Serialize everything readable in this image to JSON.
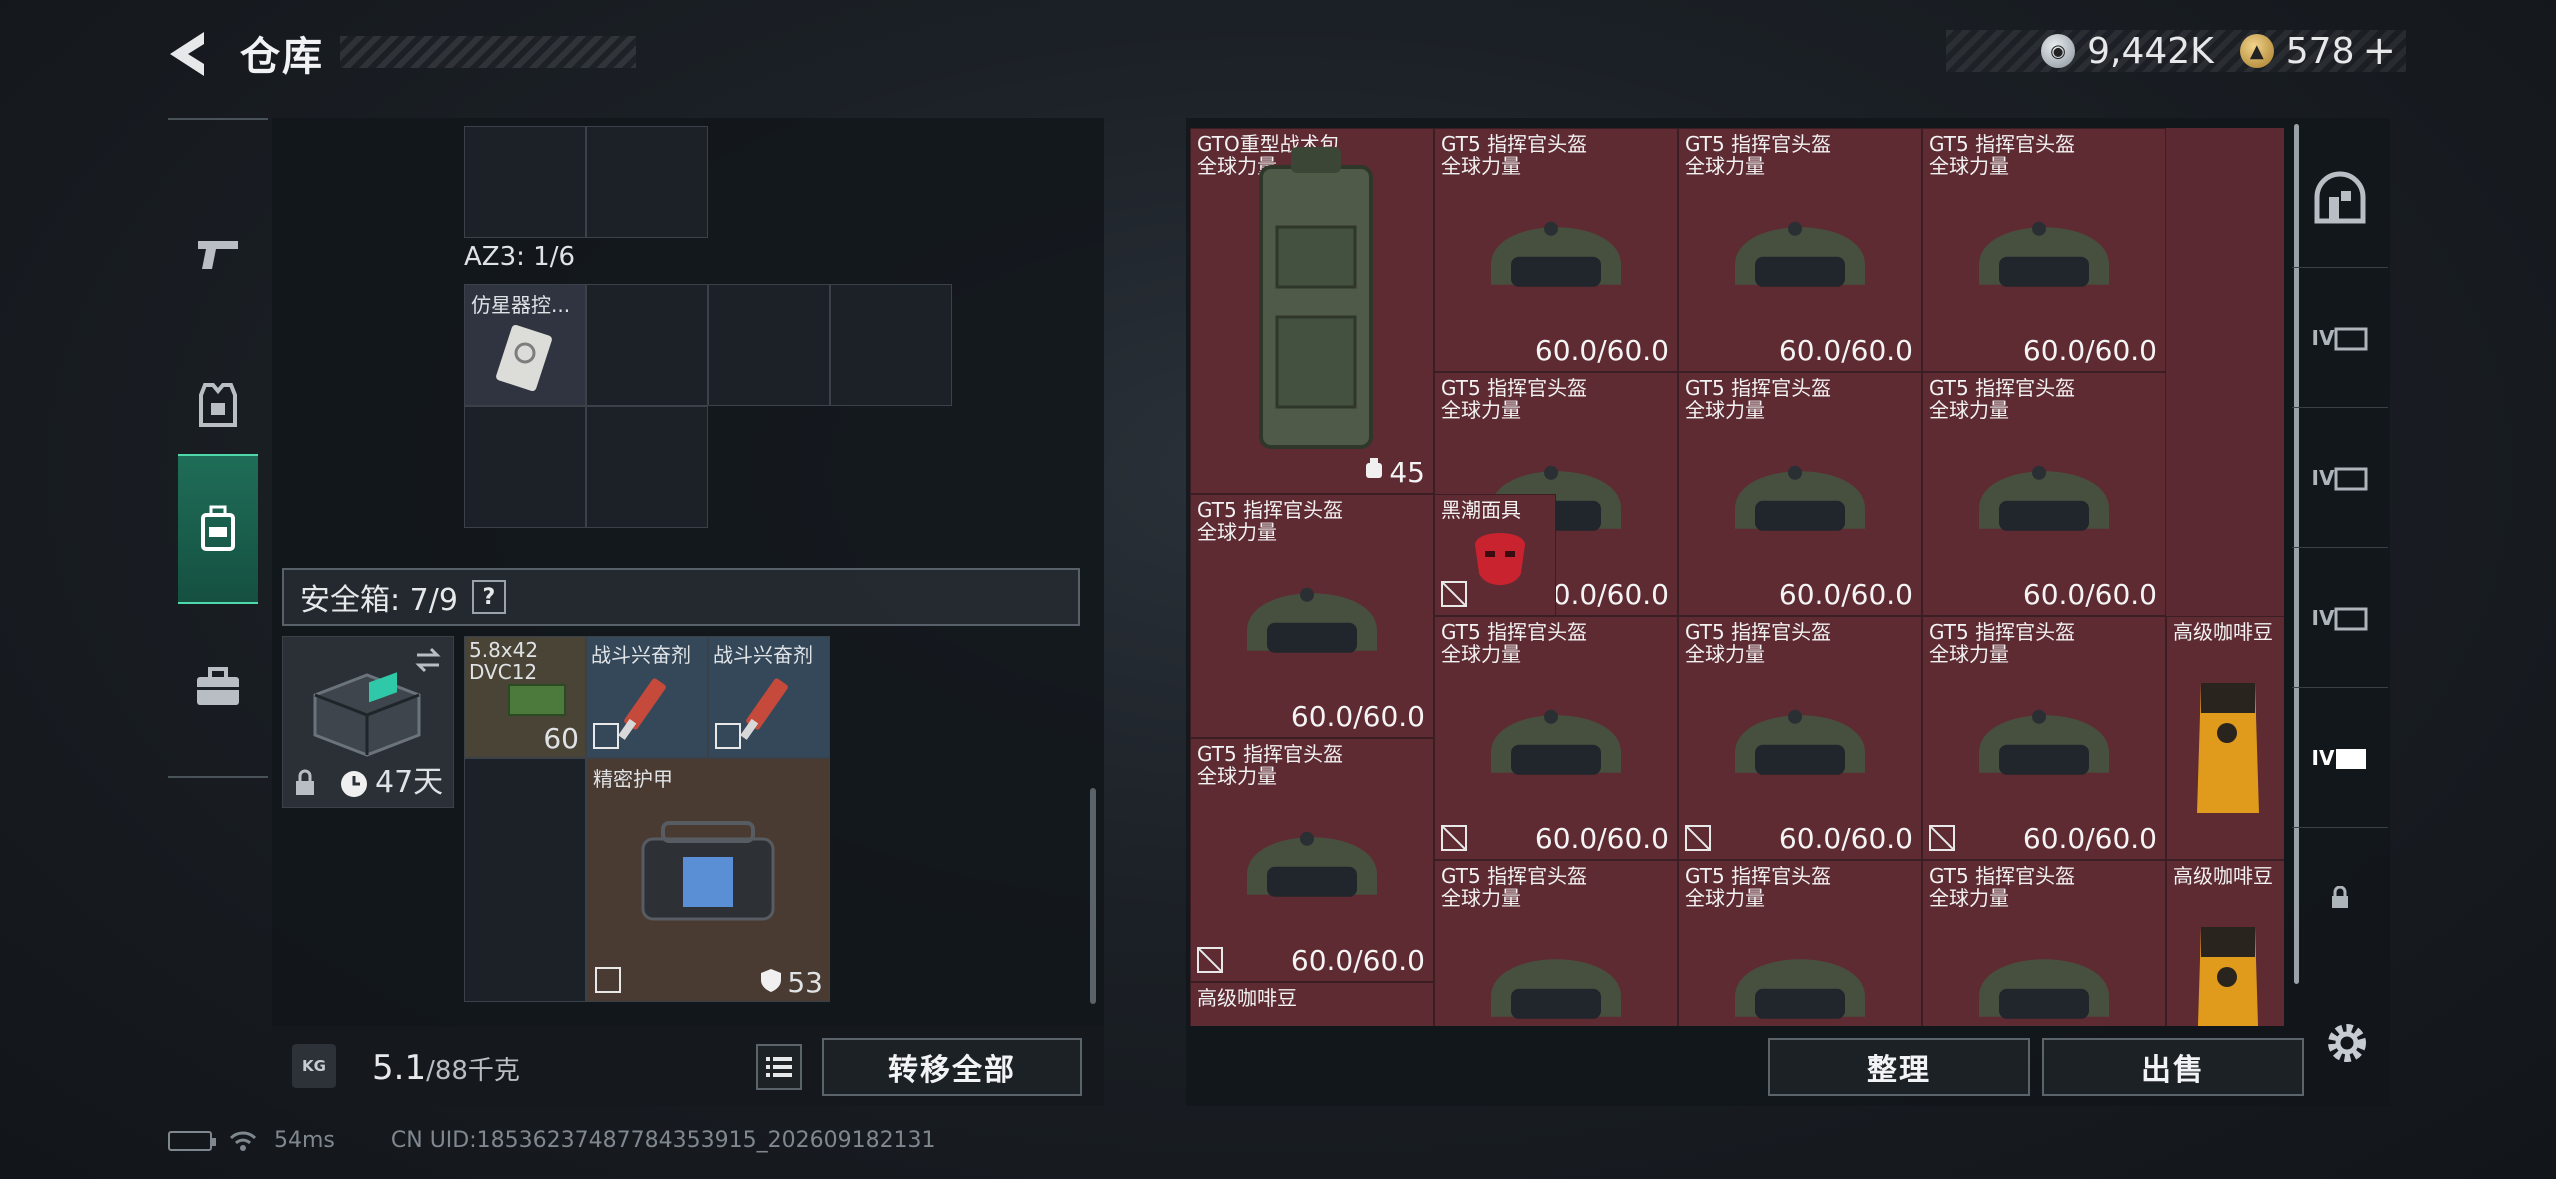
{
  "header": {
    "title": "仓库",
    "currency": [
      {
        "icon": "silver-coin-icon",
        "value": "9,442K"
      },
      {
        "icon": "gold-coin-icon",
        "value": "578"
      }
    ],
    "plus": "+"
  },
  "left_nav": [
    {
      "icon": "pistol-icon",
      "active": false
    },
    {
      "icon": "vest-icon",
      "active": false
    },
    {
      "icon": "backpack-icon",
      "active": true
    },
    {
      "icon": "toolbox-icon",
      "active": false
    }
  ],
  "left_panel": {
    "az3_label": "AZ3: 1/6",
    "az3_item": "仿星器控...",
    "safe_label": "安全箱: 7/9",
    "safe_help": "?",
    "safe_box_days": "47天",
    "items": [
      {
        "name": "5.8x42\nDVC12",
        "qty": "60"
      },
      {
        "name": "战斗兴奋剂",
        "qty": ""
      },
      {
        "name": "战斗兴奋剂",
        "qty": ""
      },
      {
        "name": "精密护甲",
        "qty": "53"
      }
    ],
    "weight_icon": "KG",
    "weight_current": "5.1",
    "weight_max": "/88千克",
    "transfer_all": "转移全部"
  },
  "right_panel": {
    "items": [
      {
        "name": "GTO重型战术包\n全球力量",
        "qty": "45"
      },
      {
        "name": "GT5 指挥官头盔\n全球力量",
        "qty": "60.0/60.0"
      },
      {
        "name": "GT5 指挥官头盔\n全球力量",
        "qty": "60.0/60.0"
      },
      {
        "name": "GT5 指挥官头盔\n全球力量",
        "qty": "60.0/60.0"
      },
      {
        "name": "GT5 指挥官头盔\n全球力量",
        "qty": "60.0/60.0"
      },
      {
        "name": "GT5 指挥官头盔\n全球力量",
        "qty": "60.0/60.0"
      },
      {
        "name": "GT5 指挥官头盔\n全球力量",
        "qty": "60.0/60.0"
      },
      {
        "name": "GT5 指挥官头盔\n全球力量",
        "qty": "60.0/60.0"
      },
      {
        "name": "黑潮面具",
        "qty": ""
      },
      {
        "name": "GT5 指挥官头盔\n全球力量",
        "qty": "60.0/60.0"
      },
      {
        "name": "GT5 指挥官头盔\n全球力量",
        "qty": "60.0/60.0"
      },
      {
        "name": "GT5 指挥官头盔\n全球力量",
        "qty": "60.0/60.0"
      },
      {
        "name": "高级咖啡豆",
        "qty": ""
      },
      {
        "name": "GT5 指挥官头盔\n全球力量",
        "qty": "60.0/60.0"
      },
      {
        "name": "GT5 指挥官头盔\n全球力量",
        "qty": ""
      },
      {
        "name": "GT5 指挥官头盔\n全球力量",
        "qty": ""
      },
      {
        "name": "GT5 指挥官头盔\n全球力量",
        "qty": ""
      },
      {
        "name": "高级咖啡豆",
        "qty": ""
      },
      {
        "name": "高级咖啡豆",
        "qty": ""
      }
    ],
    "rail": [
      "IV",
      "IV",
      "IV",
      "IV"
    ],
    "organize": "整理",
    "sell": "出售"
  },
  "footer": {
    "ping": "54ms",
    "uid": "CN UID:18536237487784353915_202609182131"
  },
  "colors": {
    "accent_green": "#1f6d58",
    "item_red": "#5e2b33",
    "panel": "#12161b"
  }
}
